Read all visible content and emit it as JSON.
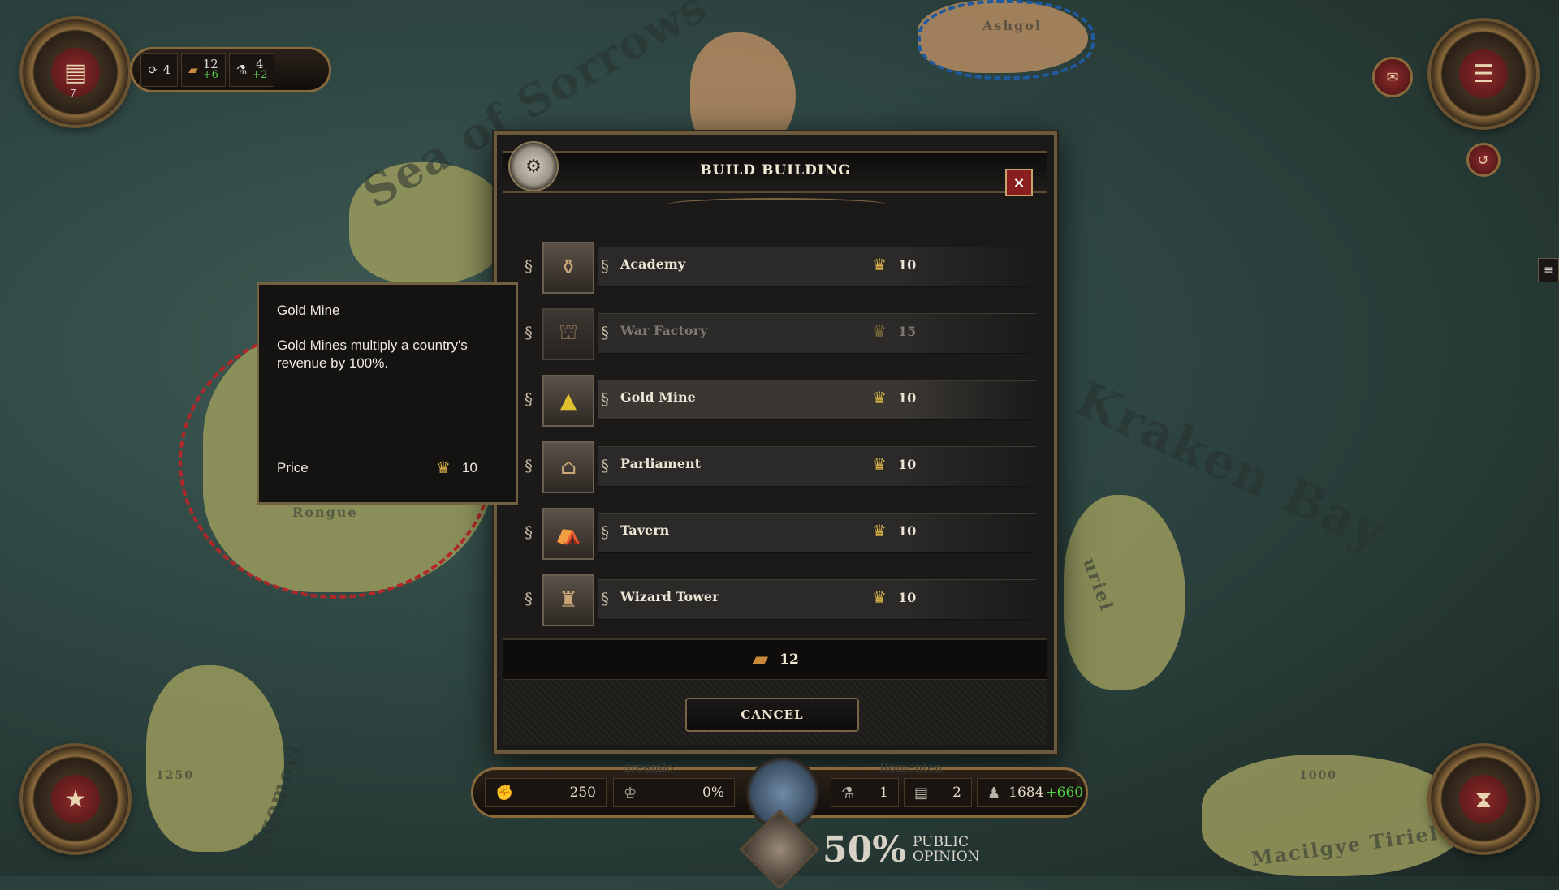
{
  "map": {
    "labels": [
      "Sea of Sorrows",
      "Kraken Bay",
      "Ashgol",
      "Rongue",
      "Ilgemoyl",
      "Macilgye Tiriel",
      "uriel",
      "1000",
      "1250"
    ]
  },
  "top_left": {
    "cards_count": "7",
    "turn_value": "4",
    "gold_value": "12",
    "gold_change": "+6",
    "potion_value": "4",
    "potion_change": "+2"
  },
  "dialog": {
    "title": "BUILD BUILDING",
    "close_label": "×",
    "buildings": [
      {
        "name": "Academy",
        "price": "10",
        "icon": "academy-icon",
        "state": "normal"
      },
      {
        "name": "War Factory",
        "price": "15",
        "icon": "war-factory-icon",
        "state": "disabled"
      },
      {
        "name": "Gold Mine",
        "price": "10",
        "icon": "gold-mine-icon",
        "state": "selected"
      },
      {
        "name": "Parliament",
        "price": "10",
        "icon": "parliament-icon",
        "state": "normal"
      },
      {
        "name": "Tavern",
        "price": "10",
        "icon": "tavern-icon",
        "state": "normal"
      },
      {
        "name": "Wizard Tower",
        "price": "10",
        "icon": "wizard-tower-icon",
        "state": "normal"
      }
    ],
    "treasury_amount": "12",
    "cancel_label": "CANCEL"
  },
  "tooltip": {
    "title": "Gold Mine",
    "description": "Gold Mines multiply a country's revenue by 100%.",
    "price_label": "Price",
    "price": "10"
  },
  "hud": {
    "left_label": "dreamlo",
    "right_label": "Romenten",
    "army_value": "250",
    "tax_value": "0%",
    "potion_value": "1",
    "cards_value": "2",
    "population_value": "1684",
    "population_change": "+660",
    "public_opinion_pct": "50%",
    "public_opinion_label_1": "PUBLIC",
    "public_opinion_label_2": "OPINION"
  },
  "colors": {
    "accent_gold": "#d9b34a",
    "frame_brass": "#8a6a3c",
    "close_red": "#8a1d1d",
    "positive_green": "#4fcf47"
  }
}
